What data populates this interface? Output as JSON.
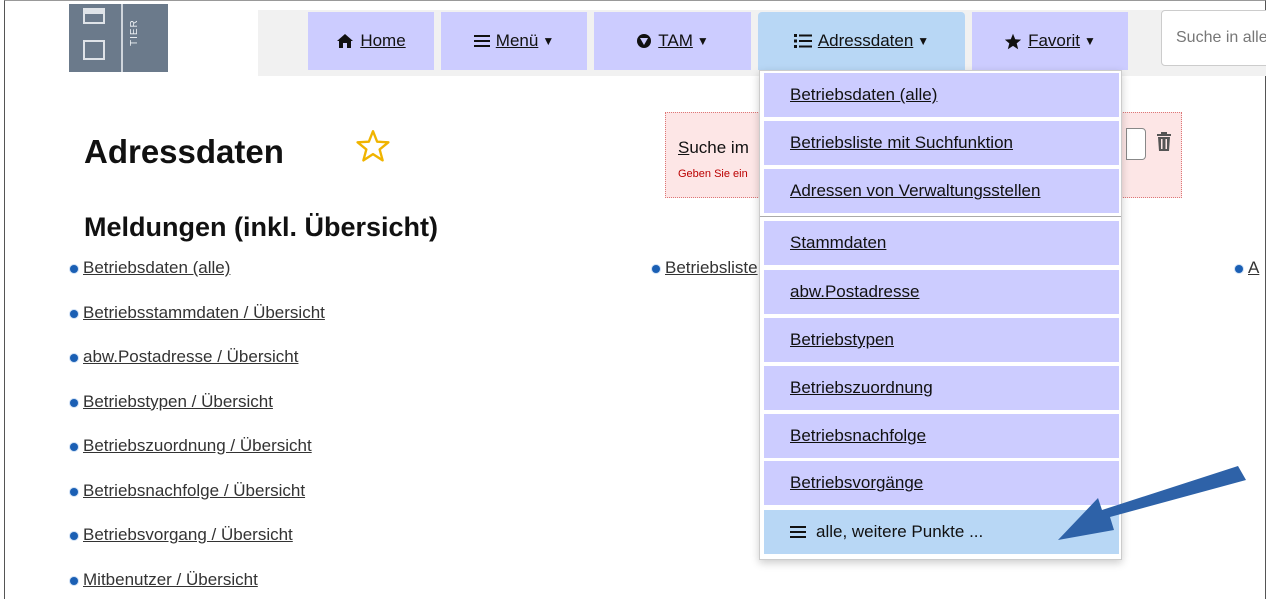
{
  "logo": {
    "text": "TIER"
  },
  "nav": {
    "items": [
      {
        "label": "Home",
        "icon": "home-icon"
      },
      {
        "label": "Menü",
        "icon": "hamburger-icon"
      },
      {
        "label": "TAM",
        "icon": "tam-icon"
      },
      {
        "label": "Adressdaten",
        "icon": "list-icon"
      },
      {
        "label": "Favorit",
        "icon": "star-icon"
      }
    ],
    "search_placeholder": "Suche in alle"
  },
  "page": {
    "title": "Adressdaten",
    "favorite_icon": "star-outline-icon",
    "section_title": "Meldungen (inkl. Übersicht)"
  },
  "alert": {
    "label_underlined": "S",
    "label_rest": "uche im",
    "hint": "Geben Sie ein"
  },
  "links": [
    "Betriebsdaten (alle)",
    "Betriebsstammdaten / Übersicht",
    "abw.Postadresse / Übersicht",
    "Betriebstypen / Übersicht",
    "Betriebszuordnung / Übersicht",
    "Betriebsnachfolge / Übersicht",
    "Betriebsvorgang / Übersicht",
    "Mitbenutzer / Übersicht"
  ],
  "col2_link": "Betriebsliste",
  "col3_link": "A",
  "dropdown": {
    "items": [
      "Betriebsdaten (alle)",
      "Betriebsliste mit Suchfunktion",
      "Adressen von Verwaltungsstellen",
      "Stammdaten",
      "abw.Postadresse",
      "Betriebstypen",
      "Betriebszuordnung",
      "Betriebsnachfolge",
      "Betriebsvorgänge"
    ],
    "more_label": "alle, weitere Punkte ..."
  },
  "colors": {
    "nav_button": "#ccccff",
    "nav_active": "#b8d7f5",
    "arrow": "#2e62a8",
    "star_outline": "#f0b400"
  }
}
